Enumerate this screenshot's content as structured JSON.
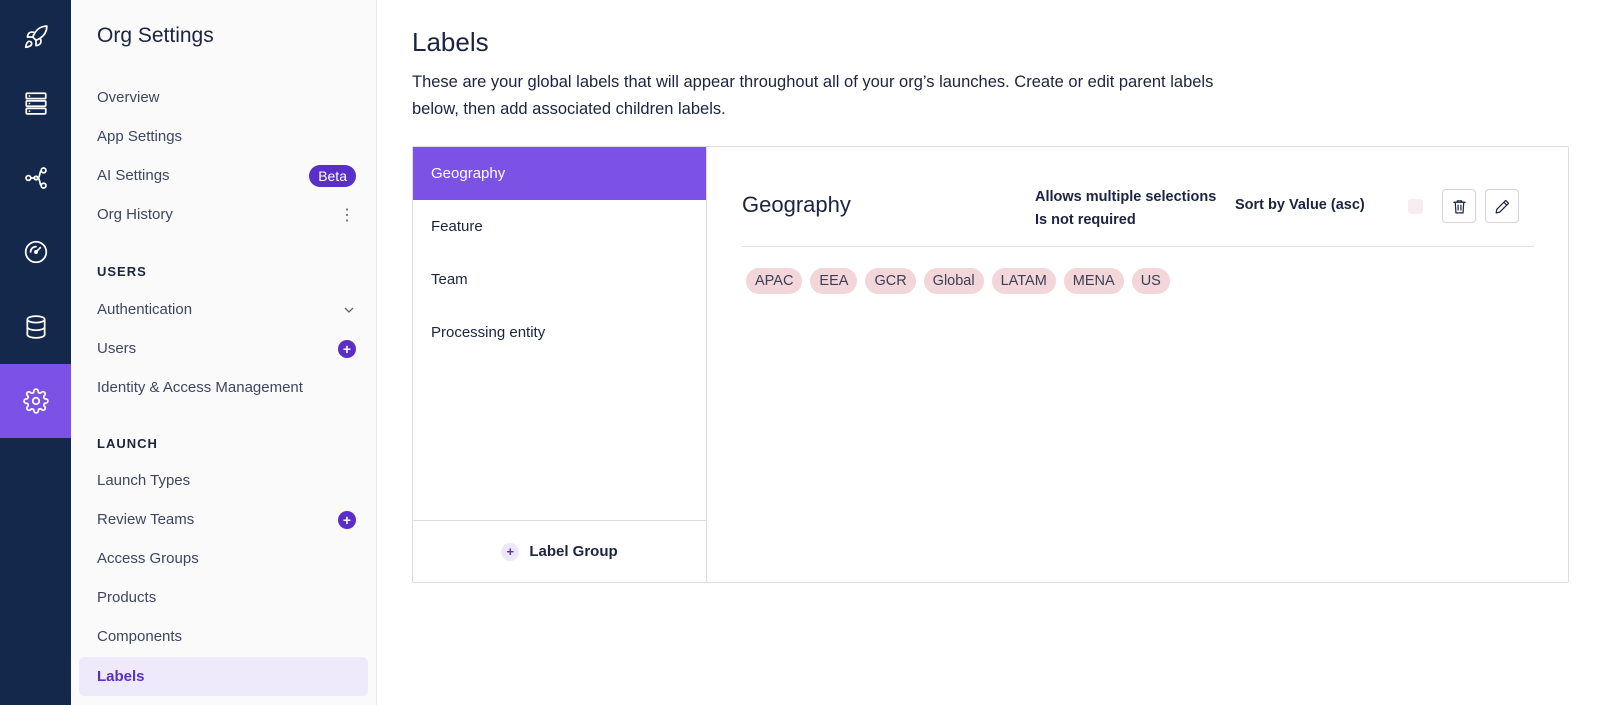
{
  "rail": {
    "items": [
      {
        "icon": "rocket-icon"
      },
      {
        "icon": "server-icon"
      },
      {
        "icon": "workflow-icon"
      },
      {
        "icon": "dashboard-icon"
      },
      {
        "icon": "database-icon"
      },
      {
        "icon": "gear-icon",
        "active": true
      }
    ]
  },
  "sidebar": {
    "title": "Org Settings",
    "top_items": [
      {
        "label": "Overview"
      },
      {
        "label": "App Settings"
      },
      {
        "label": "AI Settings",
        "badge": "Beta"
      },
      {
        "label": "Org History"
      }
    ],
    "users_section": "USERS",
    "users_items": [
      {
        "label": "Authentication"
      },
      {
        "label": "Users"
      },
      {
        "label": "Identity & Access Management"
      }
    ],
    "launch_section": "LAUNCH",
    "launch_items": [
      {
        "label": "Launch Types"
      },
      {
        "label": "Review Teams"
      },
      {
        "label": "Access Groups"
      },
      {
        "label": "Products"
      },
      {
        "label": "Components"
      },
      {
        "label": "Labels",
        "active": true
      }
    ]
  },
  "main": {
    "title": "Labels",
    "description": "These are your global labels that will appear throughout all of your org’s launches. Create or edit parent labels below, then add associated children labels.",
    "groups": [
      {
        "label": "Geography",
        "active": true
      },
      {
        "label": "Feature"
      },
      {
        "label": "Team"
      },
      {
        "label": "Processing entity"
      }
    ],
    "add_group_label": "Label Group",
    "detail": {
      "title": "Geography",
      "multi": "Allows multiple selections",
      "required": "Is not required",
      "sort": "Sort by Value (asc)",
      "chips": [
        "APAC",
        "EEA",
        "GCR",
        "Global",
        "LATAM",
        "MENA",
        "US"
      ]
    }
  },
  "colors": {
    "rail_bg": "#13284b",
    "accent": "#7c52e6",
    "accent_dark": "#5a2fc8",
    "chip_bg": "#f2d6d9"
  }
}
